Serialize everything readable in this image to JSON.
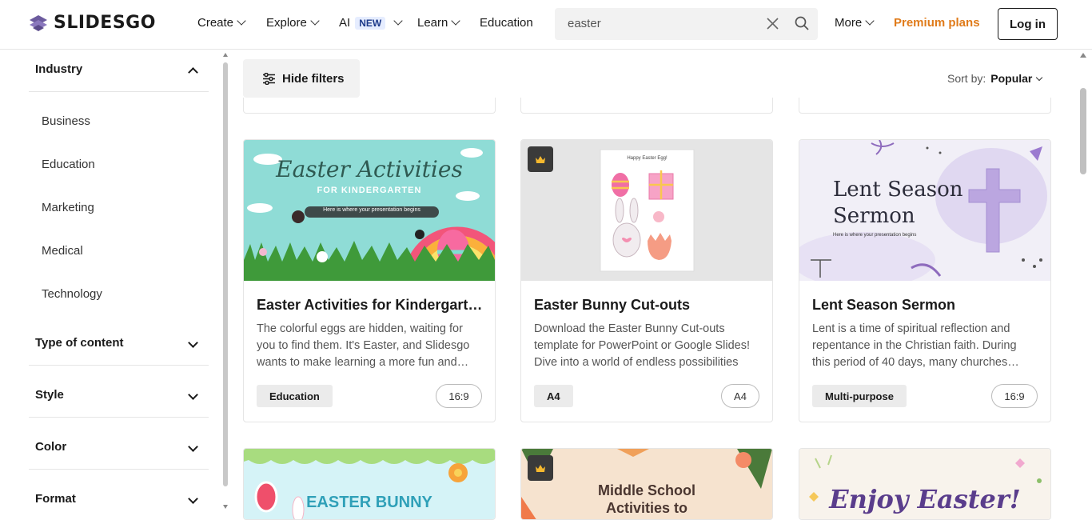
{
  "brand": {
    "name": "SLIDESGO",
    "accent": "#e07b1a"
  },
  "nav": {
    "create": "Create",
    "explore": "Explore",
    "ai": "AI",
    "ai_badge": "NEW",
    "learn": "Learn",
    "education": "Education",
    "more": "More",
    "premium": "Premium plans",
    "login": "Log in"
  },
  "search": {
    "value": "easter"
  },
  "sidebar": {
    "industry": {
      "label": "Industry",
      "options": [
        "Business",
        "Education",
        "Marketing",
        "Medical",
        "Technology"
      ]
    },
    "type_of_content": "Type of content",
    "style": "Style",
    "color": "Color",
    "format": "Format"
  },
  "toolbar": {
    "hide_filters": "Hide filters",
    "sort_label": "Sort by:",
    "sort_value": "Popular"
  },
  "cards": [
    {
      "title": "Easter Activities for Kindergarten",
      "description": "The colorful eggs are hidden, waiting for you to find them. It's Easter, and Slidesgo wants to make learning a more fun and engaging experience for kindergarteners",
      "tag": "Education",
      "ratio": "16:9",
      "premium": false,
      "thumb_title": "Easter Activities",
      "thumb_subtitle": "FOR KINDERGARTEN",
      "thumb_tagline": "Here is where your presentation begins"
    },
    {
      "title": "Easter Bunny Cut-outs",
      "description": "Download the Easter Bunny Cut-outs template for PowerPoint or Google Slides! Dive into a world of endless possibilities",
      "tag": "A4",
      "ratio": "A4",
      "premium": true,
      "thumb_title": "Happy Easter Egg!"
    },
    {
      "title": "Lent Season Sermon",
      "description": "Lent is a time of spiritual reflection and repentance in the Christian faith. During this period of 40 days, many churches celebrate",
      "tag": "Multi-purpose",
      "ratio": "16:9",
      "premium": false,
      "thumb_title_1": "Lent Season",
      "thumb_title_2": "Sermon",
      "thumb_tagline": "Here is where your presentation begins"
    }
  ],
  "bottom_cards": [
    {
      "thumb_title": "EASTER BUNNY"
    },
    {
      "thumb_title_1": "Middle School",
      "thumb_title_2": "Activities to"
    },
    {
      "thumb_title": "Enjoy Easter!"
    }
  ]
}
